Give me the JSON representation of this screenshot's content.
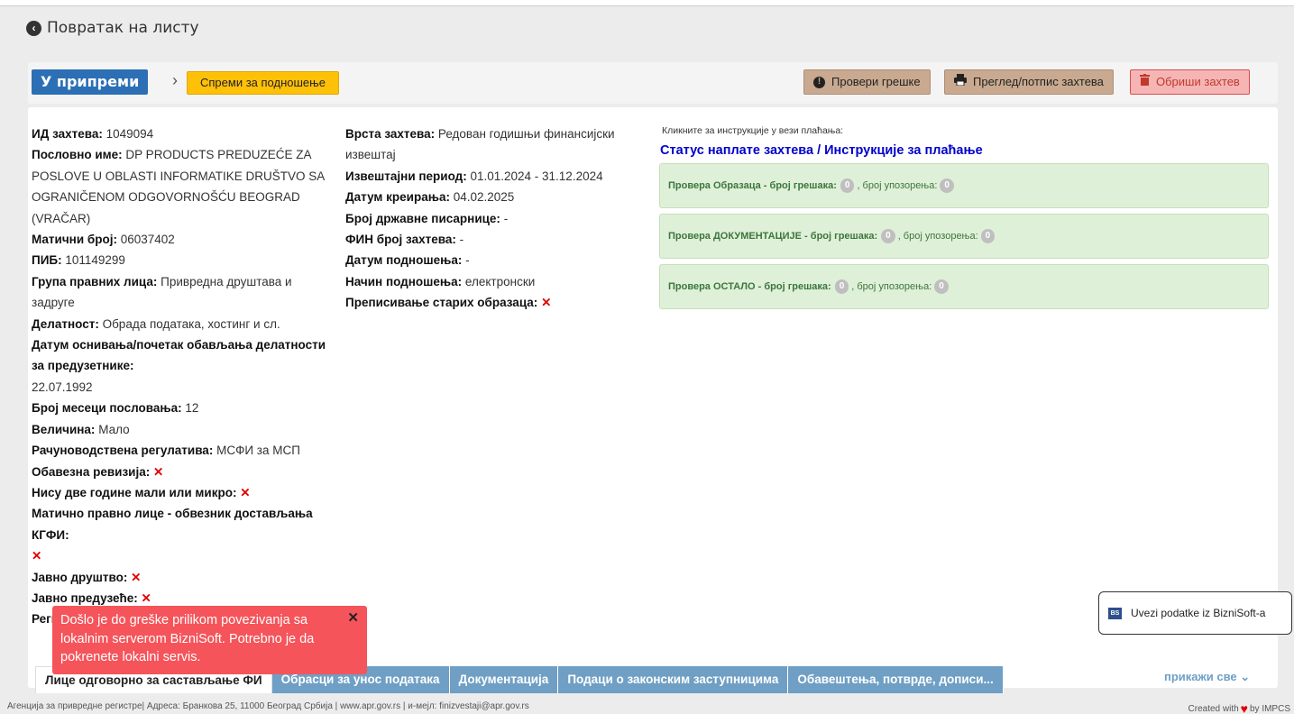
{
  "nav": {
    "back_label": "Повратак на листу"
  },
  "status": {
    "current": "У припреми",
    "next_action": "Спреми за подношење",
    "buttons": {
      "check_errors": "Провери грешке",
      "preview_sign": "Преглед/потпис захтева",
      "delete": "Обриши захтев"
    }
  },
  "details_left": [
    {
      "label": "ИД захтева:",
      "value": " 1049094"
    },
    {
      "label": "Пословно име:",
      "value": " DP PRODUCTS PREDUZEĆE ZA POSLOVE U OBLASTI INFORMATIKE DRUŠTVO SA OGRANIČENOM ODGOVORNOŠĆU BEOGRAD (VRAČAR)"
    },
    {
      "label": "Матични број:",
      "value": "  06037402"
    },
    {
      "label": "ПИБ:",
      "value": "  101149299"
    },
    {
      "label": "Група правних лица:",
      "value": "  Привредна друштава и задруге"
    },
    {
      "label": "Делатност:",
      "value": "  Обрада података, хостинг и сл."
    },
    {
      "label": "Датум оснивања/почетак обављања делатности за предузетнике:",
      "value": "22.07.1992",
      "value_newline": true
    },
    {
      "label": "Број месеци пословања:",
      "value": "  12"
    },
    {
      "label": "Величина:",
      "value": "  Мало"
    },
    {
      "label": "Рачуноводствена регулатива:",
      "value": "  МСФИ  за МСП"
    },
    {
      "label": "Обавезна ревизија:",
      "x": true
    },
    {
      "label": "Нису две године мали или микро:",
      "x": true
    },
    {
      "label": "Матично правно лице - обвезник достављања КГФИ:",
      "x": true,
      "x_newline": true
    },
    {
      "label": "Јавно друштво:",
      "x": true
    },
    {
      "label": "Јавно предузеће:",
      "x": true
    },
    {
      "label": "Регистар:",
      "value": ""
    }
  ],
  "details_mid": [
    {
      "label": "Врста захтева:",
      "value": "  Редован годишњи финансијски извештај"
    },
    {
      "label": "Извештајни период:",
      "value": "  01.01.2024 - 31.12.2024"
    },
    {
      "label": "Датум креирања:",
      "value": "  04.02.2025"
    },
    {
      "label": "Број државне писарнице:",
      "value": "  -"
    },
    {
      "label": "ФИН број захтева:",
      "value": "  -"
    },
    {
      "label": "Датум подношења:",
      "value": "  -"
    },
    {
      "label": "Начин подношења:",
      "value": "  електронски"
    },
    {
      "label": "Преписивање старих образаца:",
      "x": true
    }
  ],
  "payment": {
    "hint": "Кликните за инструкције у вези плаћања:",
    "link": "Статус наплате захтева / Инструкције за плаћање"
  },
  "checks": [
    {
      "label": "Провера Образаца - број грешака:",
      "errors": "0",
      "warn_label": ", број упозорења:",
      "warnings": "0"
    },
    {
      "label": "Провера ДОКУМЕНТАЦИЈЕ - број грешака:",
      "errors": "0",
      "warn_label": ", број упозорења:",
      "warnings": "0"
    },
    {
      "label": "Провера ОСТАЛО - број грешака:",
      "errors": "0",
      "warn_label": ", број упозорења:",
      "warnings": "0"
    }
  ],
  "tabs": [
    "Лице одговорно за састављање ФИ",
    "Обрасци за унос података",
    "Документација",
    "Подаци о законским заступницима",
    "Обавештења, потврде, дописи..."
  ],
  "show_all": "прикажи све",
  "toast": {
    "message": "Došlo je do greške prilikom povezivanja sa lokalnim serverom BizniSoft. Potrebno je da pokrenete lokalni servis.",
    "close": "✕"
  },
  "bizni": {
    "icon_text": "BS",
    "label": "Uvezi podatke iz BizniSoft-a"
  },
  "footer": {
    "left": "Агенција за привредне регистре| Адреса: Бранкова 25, 11000 Београд Србија | www.apr.gov.rs | и-мејл: finizvestaji@apr.gov.rs",
    "right_prefix": "Created with",
    "right_suffix": "by IMPCS"
  },
  "colors": {
    "status_blue": "#2c6fb5",
    "warning_yellow": "#ffc107",
    "tab_blue": "#6f9fc4",
    "toast_red": "#f5545a",
    "success_bg": "#dff0d8"
  },
  "icons": {
    "back": "circle-chevron-left-icon",
    "check": "exclamation-circle-icon",
    "print": "print-icon",
    "delete": "trash-icon",
    "x_mark": "x-mark-icon",
    "heart": "heart-icon"
  }
}
